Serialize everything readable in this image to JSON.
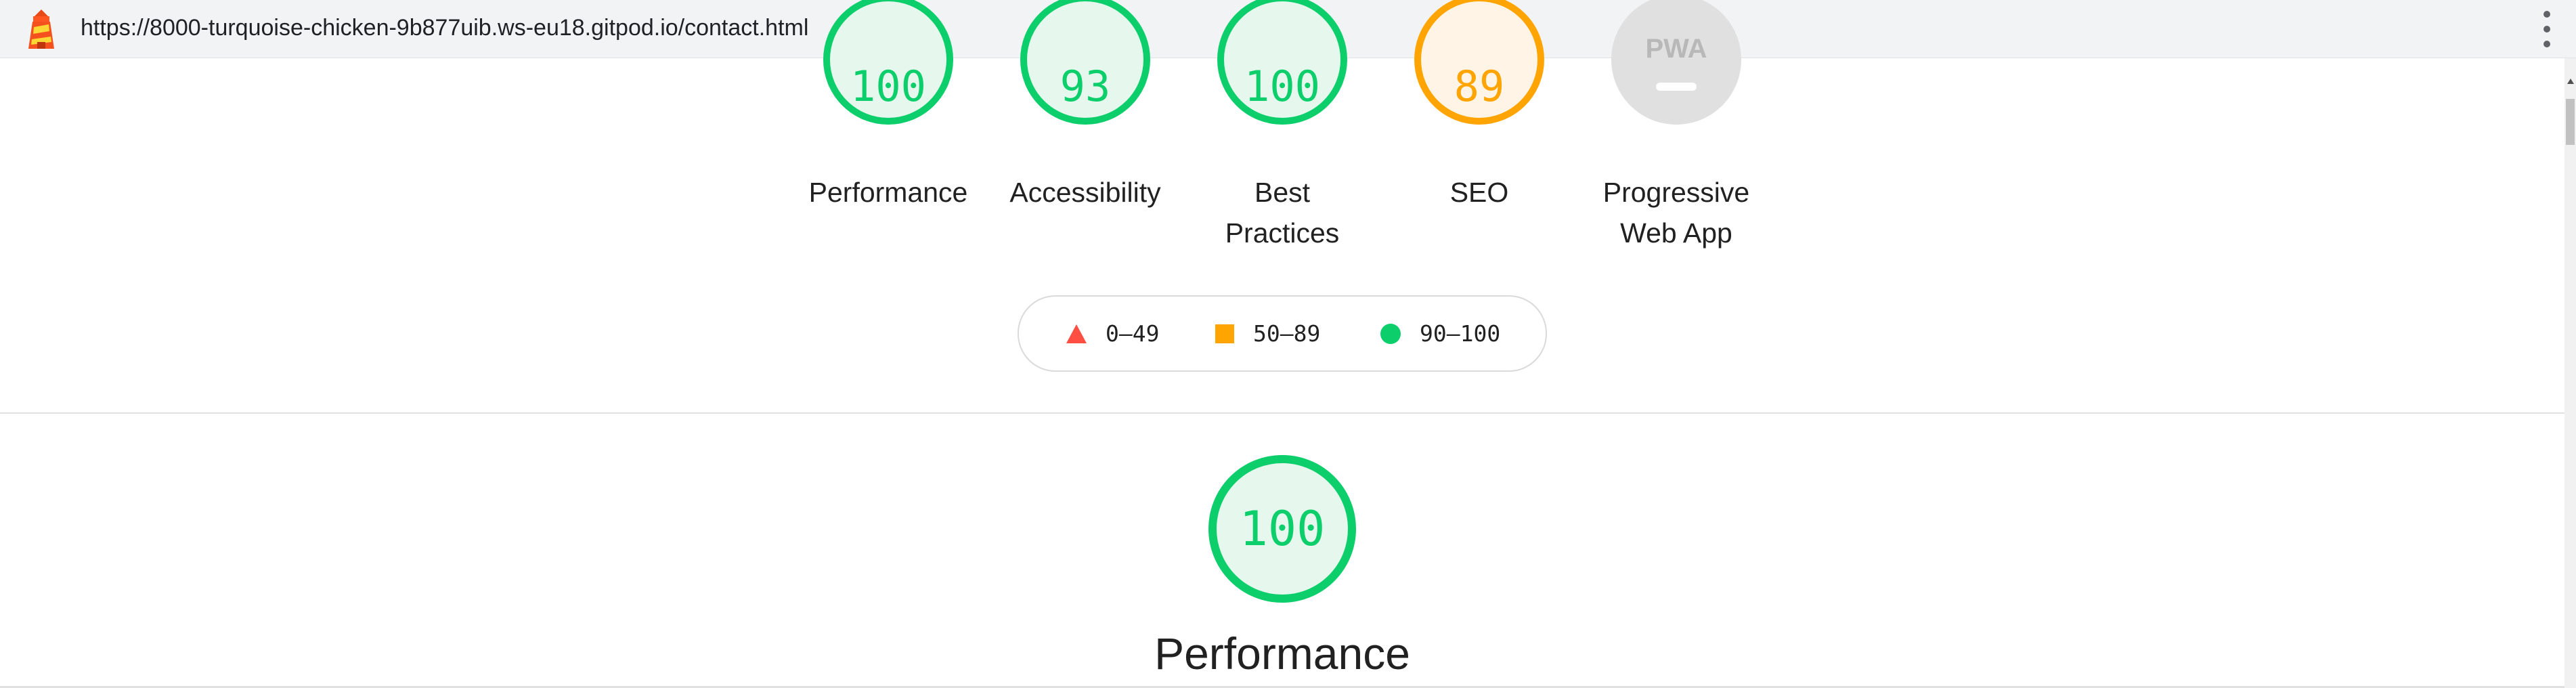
{
  "browser": {
    "url": "https://8000-turquoise-chicken-9b877uib.ws-eu18.gitpod.io/contact.html",
    "logo_icon": "lighthouse-icon",
    "menu_icon": "more-vert-icon"
  },
  "gauges": [
    {
      "score": "100",
      "label_line1": "Performance",
      "label_line2": "",
      "status": "pass"
    },
    {
      "score": "93",
      "label_line1": "Accessibility",
      "label_line2": "",
      "status": "pass"
    },
    {
      "score": "100",
      "label_line1": "Best",
      "label_line2": "Practices",
      "status": "pass"
    },
    {
      "score": "89",
      "label_line1": "SEO",
      "label_line2": "",
      "status": "average"
    },
    {
      "badge": "PWA",
      "label_line1": "Progressive",
      "label_line2": "Web App",
      "status": "na"
    }
  ],
  "legend": {
    "fail": "0–49",
    "average": "50–89",
    "pass": "90–100"
  },
  "section": {
    "score": "100",
    "title": "Performance"
  },
  "colors": {
    "pass": "#0cce6b",
    "average": "#ffa400",
    "fail": "#ff4e42",
    "na": "#e0e0e0"
  }
}
